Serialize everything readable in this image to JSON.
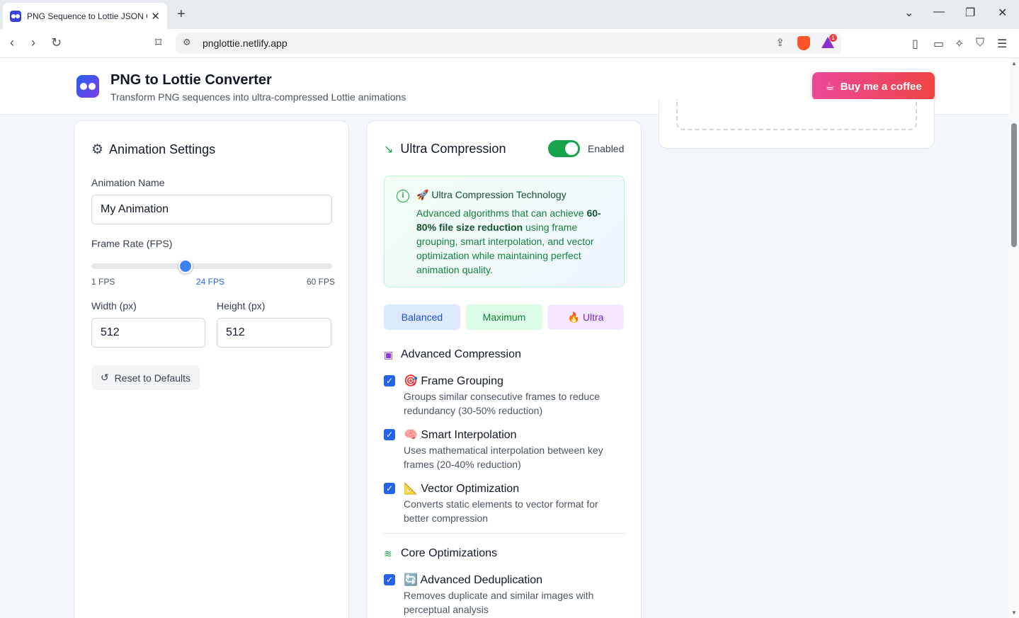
{
  "browser": {
    "tab_title": "PNG Sequence to Lottie JSON C",
    "url": "pnglottie.netlify.app",
    "rewards_badge": "1"
  },
  "header": {
    "title": "PNG to Lottie Converter",
    "subtitle": "Transform PNG sequences into ultra-compressed Lottie animations",
    "coffee_label": "Buy me a coffee"
  },
  "settings": {
    "title": "Animation Settings",
    "name_label": "Animation Name",
    "name_value": "My Animation",
    "fps_label": "Frame Rate (FPS)",
    "fps_min": "1 FPS",
    "fps_current": "24 FPS",
    "fps_max": "60 FPS",
    "fps_value": 24,
    "fps_min_value": 1,
    "fps_max_value": 60,
    "width_label": "Width (px)",
    "width_value": "512",
    "height_label": "Height (px)",
    "height_value": "512",
    "reset_label": "Reset to Defaults"
  },
  "compression": {
    "title": "Ultra Compression",
    "toggle_label": "Enabled",
    "info_title": "Ultra Compression Technology",
    "info_text_1": "Advanced algorithms that can achieve ",
    "info_text_bold": "60-80% file size reduction",
    "info_text_2": " using frame grouping, smart interpolation, and vector optimization while maintaining perfect animation quality.",
    "presets": [
      "Balanced",
      "Maximum",
      "Ultra"
    ],
    "advanced_title": "Advanced Compression",
    "options": [
      {
        "icon": "🎯",
        "title": "Frame Grouping",
        "desc": "Groups similar consecutive frames to reduce redundancy (30-50% reduction)"
      },
      {
        "icon": "🧠",
        "title": "Smart Interpolation",
        "desc": "Uses mathematical interpolation between key frames (20-40% reduction)"
      },
      {
        "icon": "📐",
        "title": "Vector Optimization",
        "desc": "Converts static elements to vector format for better compression"
      }
    ],
    "core_title": "Core Optimizations",
    "core_options": [
      {
        "icon": "🔄",
        "title": "Advanced Deduplication",
        "desc": "Removes duplicate and similar images with perceptual analysis"
      }
    ]
  },
  "colors": {
    "accent": "#2563eb",
    "enabled": "#16a34a",
    "coffee_start": "#ec4899",
    "coffee_end": "#ef4444"
  }
}
